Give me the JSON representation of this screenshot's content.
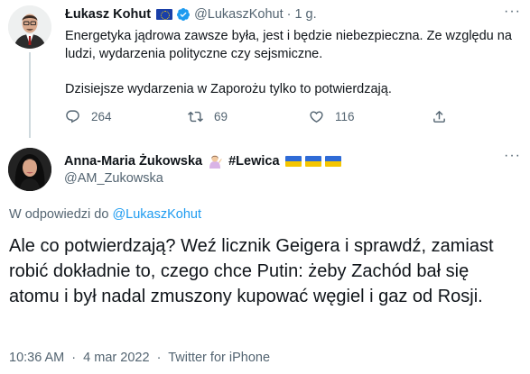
{
  "parent_tweet": {
    "author_name": "Łukasz Kohut",
    "handle": "@LukaszKohut",
    "separator": "·",
    "time": "1 g.",
    "text_lines": [
      "Energetyka jądrowa zawsze była, jest i będzie niebezpieczna. Ze względu na ludzi, wydarzenia polityczne czy sejsmiczne.",
      "Dzisiejsze wydarzenia w Zaporożu tylko to potwierdzają."
    ],
    "replies_count": "264",
    "retweets_count": "69",
    "likes_count": "116"
  },
  "reply_tweet": {
    "author_name": "Anna-Maria Żukowska",
    "hashtag": "#Lewica",
    "handle": "@AM_Zukowska",
    "reply_prefix": "W odpowiedzi do",
    "reply_to_handle": "@LukaszKohut",
    "text": "Ale co potwierdzają? Weź licznik Geigera i sprawdź, zamiast robić dokładnie to, czego chce Putin: żeby Zachód bał się atomu i był nadal zmuszony kupować węgiel i gaz od Rosji.",
    "time": "10:36 AM",
    "separator": "·",
    "date": "4 mar 2022",
    "source": "Twitter for iPhone"
  },
  "icons": {
    "eu_flag": "eu-flag-icon",
    "verified": "verified-badge-icon",
    "more": "more-icon",
    "reply": "reply-icon",
    "retweet": "retweet-icon",
    "like": "heart-icon",
    "share": "share-icon",
    "woman_gesture": "woman-gesturing-icon",
    "ukraine_flag": "ukraine-flag-icon"
  },
  "colors": {
    "accent": "#1d9bf0",
    "secondary_text": "#536471",
    "primary_text": "#0f1419"
  }
}
